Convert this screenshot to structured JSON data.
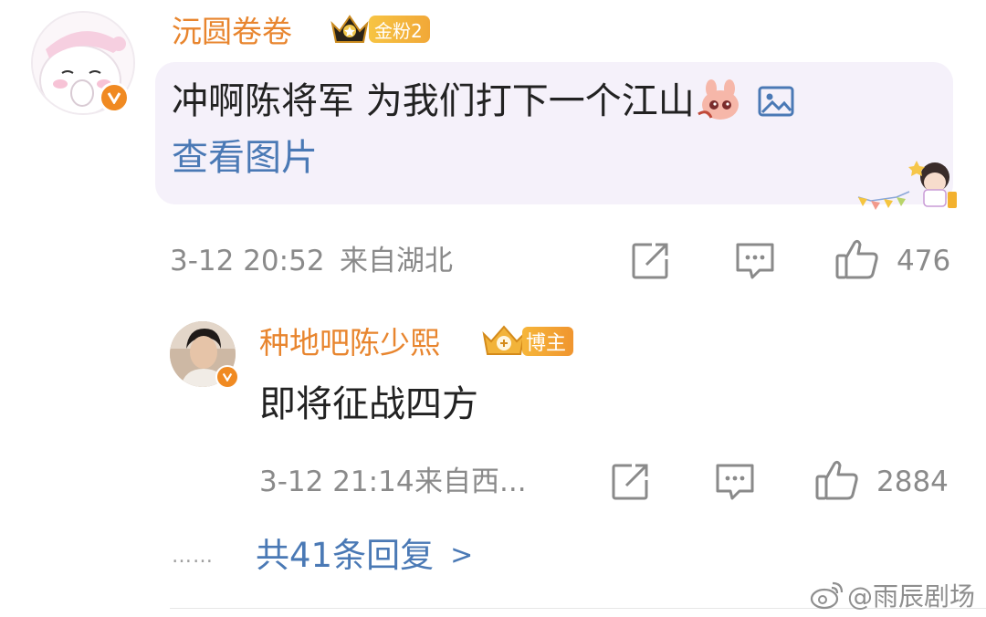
{
  "comment": {
    "username": "沅圆卷卷",
    "fan_badge": "金粉2",
    "text": "冲啊陈将军 为我们打下一个江山",
    "view_image_link": "查看图片",
    "timestamp": "3-12 20:52",
    "location": "来自湖北",
    "like_count": "476",
    "avatar_icon": "pink-bear-avatar",
    "verified_icon": "v-verified-icon",
    "crown_icon": "crown-icon",
    "emoji_icon": "pink-bunny-emoji",
    "image_icon": "image-icon"
  },
  "reply": {
    "username": "种地吧陈少熙",
    "badge": "博主",
    "text": "即将征战四方",
    "timestamp": "3-12 21:14",
    "location": "来自西...",
    "like_count": "2884",
    "avatar_icon": "man-photo-avatar"
  },
  "replies_link": {
    "dots": "……",
    "label": "共41条回复",
    "chevron": ">"
  },
  "watermark": {
    "text": "@雨辰剧场",
    "icon": "weibo-logo-icon"
  },
  "colors": {
    "username": "#e8852e",
    "link": "#4a79b5",
    "meta": "#8a8a8a",
    "bubble": "#f5f1fa",
    "verified": "#f08a22"
  }
}
